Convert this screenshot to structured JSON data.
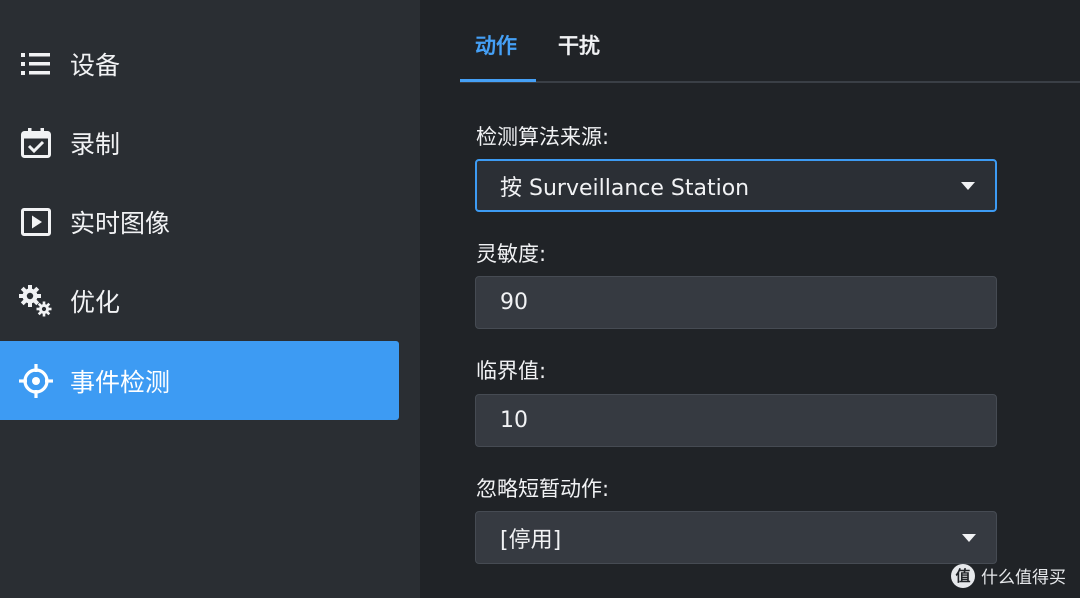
{
  "sidebar": {
    "items": [
      {
        "label": "设备",
        "icon": "list-icon",
        "active": false
      },
      {
        "label": "录制",
        "icon": "calendar-check-icon",
        "active": false
      },
      {
        "label": "实时图像",
        "icon": "play-square-icon",
        "active": false
      },
      {
        "label": "优化",
        "icon": "gears-icon",
        "active": false
      },
      {
        "label": "事件检测",
        "icon": "crosshair-icon",
        "active": true
      }
    ]
  },
  "tabs": [
    {
      "label": "动作",
      "active": true
    },
    {
      "label": "干扰",
      "active": false
    }
  ],
  "form": {
    "algorithm_source": {
      "label": "检测算法来源:",
      "value": "按 Surveillance Station"
    },
    "sensitivity": {
      "label": "灵敏度:",
      "value": "90"
    },
    "threshold": {
      "label": "临界值:",
      "value": "10"
    },
    "ignore_short": {
      "label": "忽略短暂动作:",
      "value": "[停用]"
    }
  },
  "watermark": {
    "logo": "值",
    "text": "什么值得买"
  },
  "colors": {
    "accent": "#3d9bf3",
    "sidebar_bg": "#2a2e33",
    "main_bg": "#202327",
    "field_bg": "#363a41"
  }
}
